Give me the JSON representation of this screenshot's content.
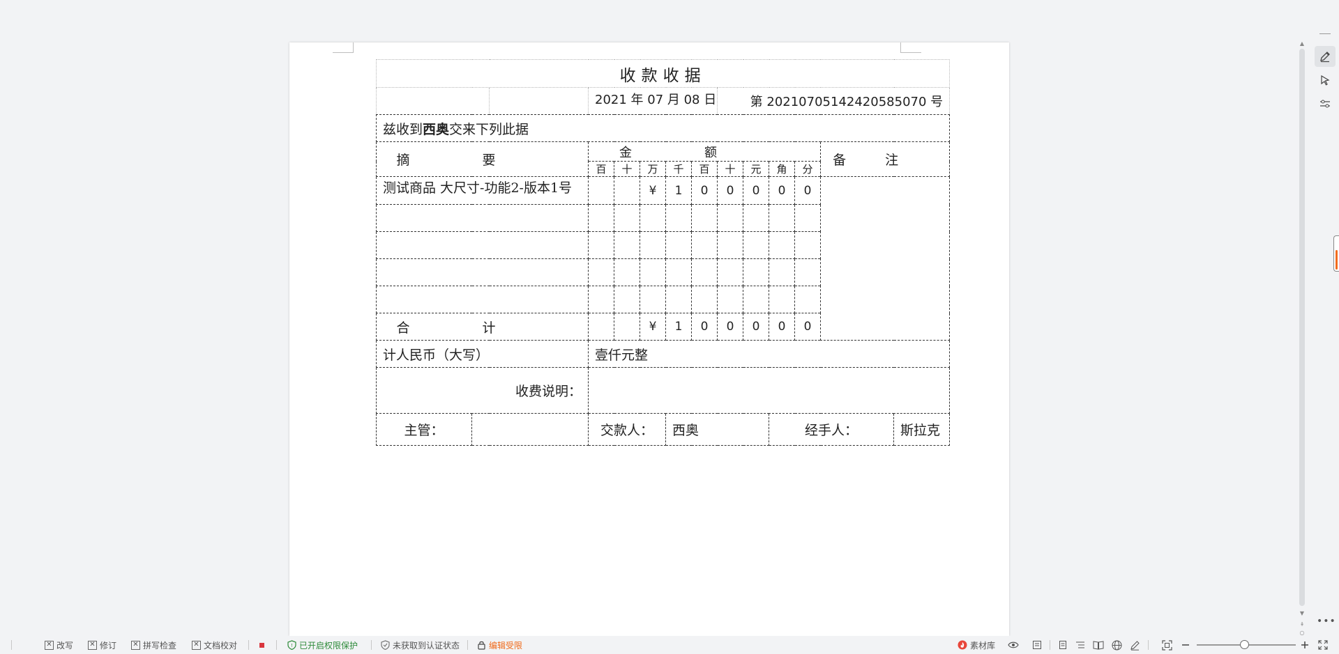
{
  "receipt": {
    "title": "收款收据",
    "date": "2021 年 07 月 08 日",
    "number": "第 20210705142420585070 号",
    "received_prefix": "兹收到",
    "payer_bold": "西奥",
    "received_suffix": "交来下列此据",
    "col_summary": "摘要",
    "col_amount": "金额",
    "col_remark": "备注",
    "units": [
      "百",
      "十",
      "万",
      "千",
      "百",
      "十",
      "元",
      "角",
      "分"
    ],
    "item_name": "测试商品 大尺寸-功能2-版本1号",
    "item_digits": [
      "",
      "",
      "¥",
      "1",
      "0",
      "0",
      "0",
      "0",
      "0"
    ],
    "total_label": "合计",
    "total_digits": [
      "",
      "",
      "¥",
      "1",
      "0",
      "0",
      "0",
      "0",
      "0"
    ],
    "rmb_label": "计人民币（大写）",
    "rmb_value": "壹仟元整",
    "fee_label": "收费说明：",
    "supervisor_label": "主管：",
    "supervisor_value": "",
    "payer_label": "交款人：",
    "payer_value": "西奥",
    "handler_label": "经手人：",
    "handler_value": "斯拉克"
  },
  "statusbar": {
    "items": [
      "改写",
      "修订",
      "拼写检查",
      "文档校对"
    ],
    "permission": "已开启权限保护",
    "auth": "未获取到认证状态",
    "edit_limit": "编辑受限",
    "material": "素材库"
  },
  "colors": {
    "accent_orange": "#f06a1a",
    "green": "#2e8b3a",
    "record_red": "#d9363e"
  }
}
